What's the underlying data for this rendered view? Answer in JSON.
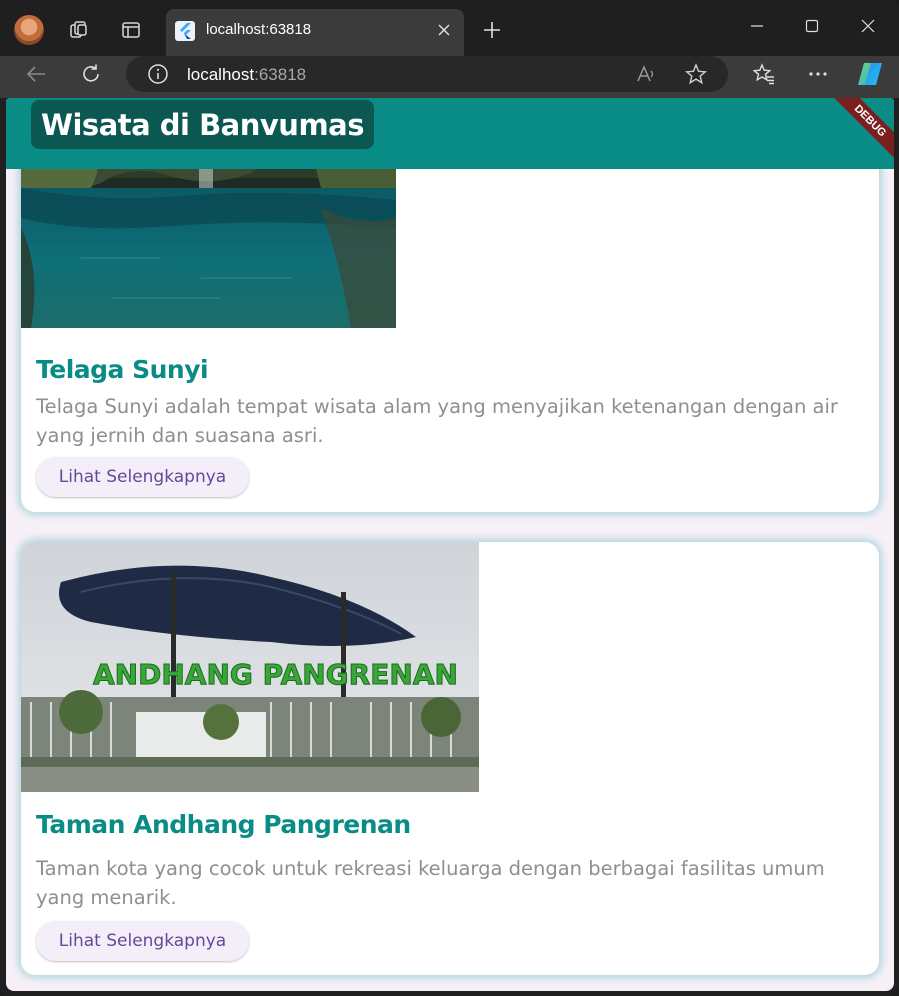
{
  "browser": {
    "tab_title": "localhost:63818",
    "url_host": "localhost",
    "url_port": ":63818"
  },
  "app": {
    "title": "Wisata di Banvumas",
    "debug_banner": "DEBUG",
    "colors": {
      "appbar": "#0a8c86",
      "title_box": "#0b5752",
      "card_title": "#0a8c86",
      "button_text": "#65479b"
    }
  },
  "cards": [
    {
      "title": "Telaga Sunyi",
      "description": "Telaga Sunyi adalah tempat wisata alam yang menyajikan ketenangan dengan air yang jernih dan suasana asri.",
      "button": "Lihat Selengkapnya"
    },
    {
      "title": "Taman Andhang Pangrenan",
      "description": "Taman kota yang cocok untuk rekreasi keluarga dengan berbagai fasilitas umum yang menarik.",
      "button": "Lihat Selengkapnya",
      "sign_text": "ANDHANG PANGRENAN"
    }
  ]
}
